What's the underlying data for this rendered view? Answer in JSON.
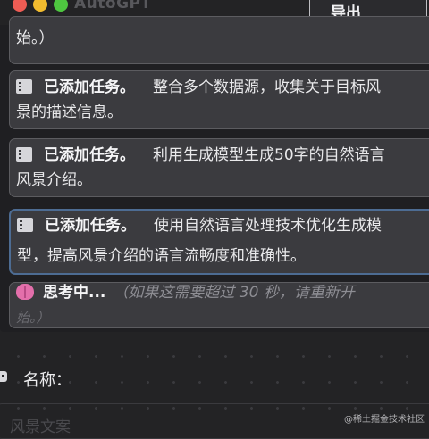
{
  "window": {
    "title": "AutoGPT"
  },
  "toolbar": {
    "export_label": "导出"
  },
  "messages": [
    {
      "lines": [
        "始。）"
      ]
    },
    {
      "header": "已添加任务。",
      "text": "整合多个数据源，收集关于目标风",
      "cont": "景的描述信息。"
    },
    {
      "header": "已添加任务。",
      "text": "利用生成模型生成50字的自然语言",
      "cont": "风景介绍。"
    },
    {
      "header": "已添加任务。",
      "text": "使用自然语言处理技术优化生成模",
      "cont": "型，提高风景介绍的语言流畅度和准确性。"
    },
    {
      "header": "思考中...",
      "text": "（如果这需要超过 30 秒，请重新开",
      "cont": "始。）"
    }
  ],
  "form": {
    "name_label": "名称：",
    "name_placeholder": "风景文案"
  },
  "watermark": "@稀土掘金技术社区",
  "colors": {
    "background": "#232325",
    "card": "#3b3b3f",
    "active_border": "#4d6c93",
    "thinking_icon": "#e36fab"
  },
  "icons": {
    "task_added": "list-icon",
    "thinking": "brain-icon",
    "agent": "robot-icon"
  }
}
